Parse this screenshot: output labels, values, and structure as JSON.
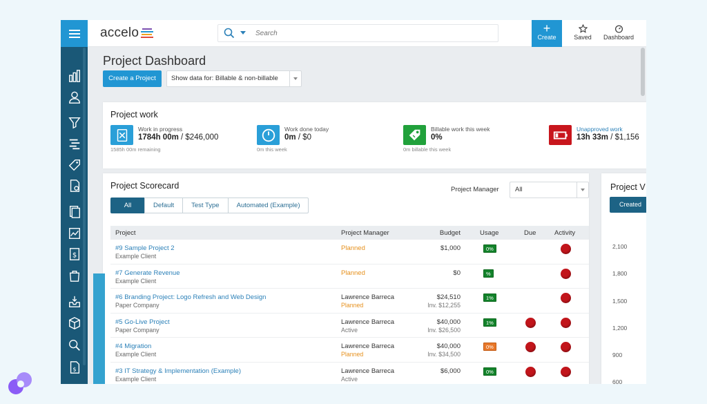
{
  "app": {
    "logo_text": "accelo",
    "search_placeholder": "Search",
    "create_label": "Create",
    "saved_label": "Saved",
    "dashboard_label": "Dashboard"
  },
  "sidebar": {
    "icons": [
      "reports-icon",
      "user-icon",
      "filter-icon",
      "projects-icon",
      "sales-tag-icon",
      "tickets-icon",
      "contracts-icon",
      "invoices-icon",
      "expenses-icon",
      "purchases-icon",
      "inbox-icon",
      "products-icon",
      "search-activity-icon",
      "documents-icon"
    ]
  },
  "header": {
    "title": "Project Dashboard",
    "create_project": "Create a Project",
    "show_data": "Show data for: ",
    "show_data_value": "Billable & non-billable"
  },
  "project_work": {
    "title": "Project work",
    "metrics": [
      {
        "label": "Work in progress",
        "value_bold": "1784h 00m",
        "value_rest": " / $246,000",
        "sub": "1585h 00m remaining",
        "color": "#2a9fd8",
        "icon": "timesheet-icon"
      },
      {
        "label": "Work done today",
        "value_bold": "0m",
        "value_rest": " / $0",
        "sub": "0m this week",
        "color": "#2a9fd8",
        "icon": "clock-icon"
      },
      {
        "label": "Billable work this week",
        "value_bold": "0%",
        "value_rest": "",
        "sub": "0m billable this week",
        "color": "#21a13b",
        "icon": "price-tag-icon"
      },
      {
        "label": "Unapproved work",
        "value_bold": "13h 33m",
        "value_rest": " / $1,156",
        "sub": "",
        "color": "#c8161d",
        "icon": "battery-icon"
      }
    ]
  },
  "scorecard": {
    "title": "Project Scorecard",
    "pm_label": "Project Manager",
    "pm_value": "All",
    "tabs": [
      "All",
      "Default",
      "Test Type",
      "Automated (Example)"
    ],
    "columns": [
      "Project",
      "Project Manager",
      "Budget",
      "Usage",
      "Due",
      "Activity"
    ],
    "rows": [
      {
        "name": "#9 Sample Project 2",
        "client": "Example Client",
        "manager": "",
        "status": "Planned",
        "status_color": "orange",
        "budget": "$1,000",
        "invoiced": "",
        "usage": "0%",
        "usage_color": "green",
        "due": false,
        "activity": true
      },
      {
        "name": "#7 Generate Revenue",
        "client": "Example Client",
        "manager": "",
        "status": "Planned",
        "status_color": "orange",
        "budget": "$0",
        "invoiced": "",
        "usage": "%",
        "usage_color": "green",
        "due": false,
        "activity": true
      },
      {
        "name": "#6 Branding Project: Logo Refresh and Web Design",
        "client": "Paper Company",
        "manager": "Lawrence Barreca",
        "status": "Planned",
        "status_color": "orange",
        "budget": "$24,510",
        "invoiced": "Inv. $12,255",
        "usage": "1%",
        "usage_color": "green",
        "due": false,
        "activity": true
      },
      {
        "name": "#5 Go-Live Project",
        "client": "Paper Company",
        "manager": "Lawrence Barreca",
        "status": "Active",
        "status_color": "gray",
        "budget": "$40,000",
        "invoiced": "Inv. $26,500",
        "usage": "1%",
        "usage_color": "green",
        "due": true,
        "activity": true
      },
      {
        "name": "#4 Migration",
        "client": "Example Client",
        "manager": "Lawrence Barreca",
        "status": "Planned",
        "status_color": "orange",
        "budget": "$40,000",
        "invoiced": "Inv. $34,500",
        "usage": "0%",
        "usage_color": "orange",
        "due": true,
        "activity": true
      },
      {
        "name": "#3 IT Strategy & Implementation (Example)",
        "client": "Example Client",
        "manager": "Lawrence Barreca",
        "status": "Active",
        "status_color": "gray",
        "budget": "$6,000",
        "invoiced": "",
        "usage": "0%",
        "usage_color": "green",
        "due": true,
        "activity": true
      }
    ]
  },
  "velocity": {
    "title": "Project V",
    "button": "Created",
    "yticks": [
      "2,100",
      "1,800",
      "1,500",
      "1,200",
      "900",
      "600"
    ]
  },
  "colors": {
    "brand_blue": "#2196d3",
    "sidebar": "#1a5877",
    "tab_active": "#1d6385",
    "alert_red": "#c2151b"
  }
}
